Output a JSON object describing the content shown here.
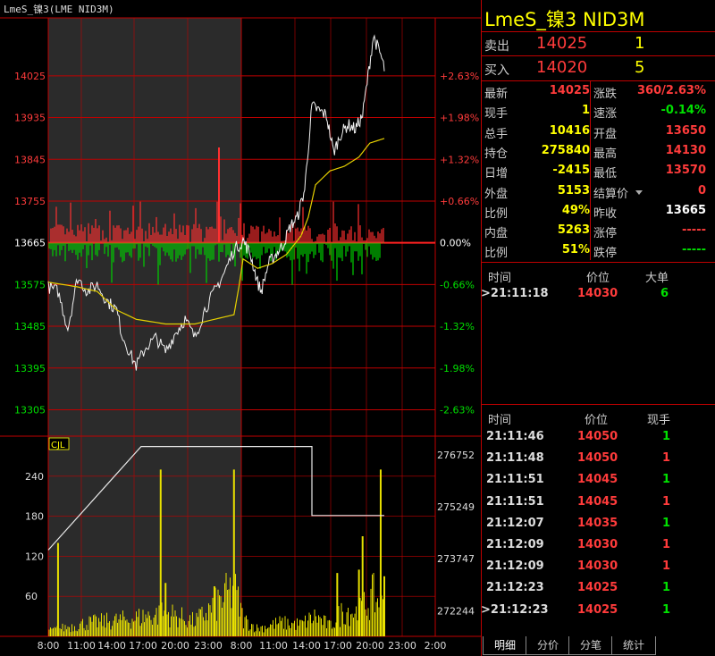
{
  "window_title": "LmeS_镍3(LME NID3M)",
  "symbol_title": "LmeS_镍3  NID3M",
  "colors": {
    "up": "#ff3b3b",
    "down": "#00e000",
    "grid": "#c00000",
    "avg": "#e6d000",
    "text_yellow": "#ffff00"
  },
  "quote": {
    "sell_label": "卖出",
    "sell_price": "14025",
    "sell_vol": "1",
    "buy_label": "买入",
    "buy_price": "14020",
    "buy_vol": "5"
  },
  "stats": [
    {
      "l": "最新",
      "v": "14025",
      "vc": "red",
      "l2": "涨跌",
      "v2": "360/2.63%",
      "v2c": "red"
    },
    {
      "l": "现手",
      "v": "1",
      "vc": "yellow",
      "l2": "速涨",
      "v2": "-0.14%",
      "v2c": "green"
    },
    {
      "l": "总手",
      "v": "10416",
      "vc": "yellow",
      "l2": "开盘",
      "v2": "13650",
      "v2c": "red"
    },
    {
      "l": "持仓",
      "v": "275840",
      "vc": "yellow",
      "l2": "最高",
      "v2": "14130",
      "v2c": "red"
    },
    {
      "l": "日增",
      "v": "-2415",
      "vc": "yellow",
      "l2": "最低",
      "v2": "13570",
      "v2c": "red"
    },
    {
      "l": "外盘",
      "v": "5153",
      "vc": "yellow",
      "l2": "结算价",
      "v2": "0",
      "v2c": "red"
    },
    {
      "l": "比例",
      "v": "49%",
      "vc": "yellow",
      "l2": "昨收",
      "v2": "13665",
      "v2c": "white"
    },
    {
      "l": "内盘",
      "v": "5263",
      "vc": "yellow",
      "l2": "涨停",
      "v2": "-----",
      "v2c": "red"
    },
    {
      "l": "比例",
      "v": "51%",
      "vc": "yellow",
      "l2": "跌停",
      "v2": "-----",
      "v2c": "green"
    }
  ],
  "big_orders": {
    "headers": [
      "时间",
      "价位",
      "大单"
    ],
    "rows": [
      {
        "time": ">21:11:18",
        "price": "14030",
        "vol": "6",
        "vc": "green"
      }
    ]
  },
  "ticks": {
    "headers": [
      "时间",
      "价位",
      "现手"
    ],
    "rows": [
      {
        "time": "21:11:46",
        "price": "14050",
        "vol": "1",
        "vc": "green"
      },
      {
        "time": "21:11:48",
        "price": "14050",
        "vol": "1",
        "vc": "red"
      },
      {
        "time": "21:11:51",
        "price": "14045",
        "vol": "1",
        "vc": "green"
      },
      {
        "time": "21:11:51",
        "price": "14045",
        "vol": "1",
        "vc": "red"
      },
      {
        "time": "21:12:07",
        "price": "14035",
        "vol": "1",
        "vc": "green"
      },
      {
        "time": "21:12:09",
        "price": "14030",
        "vol": "1",
        "vc": "red"
      },
      {
        "time": "21:12:09",
        "price": "14030",
        "vol": "1",
        "vc": "red"
      },
      {
        "time": "21:12:23",
        "price": "14025",
        "vol": "1",
        "vc": "green"
      },
      {
        "time": ">21:12:23",
        "price": "14025",
        "vol": "1",
        "vc": "green"
      }
    ]
  },
  "tabs": [
    "明细",
    "分价",
    "分笔",
    "统计"
  ],
  "chart_data": {
    "type": "line",
    "prev_close": 13665,
    "price_ticks": [
      "14025",
      "13935",
      "13845",
      "13755",
      "13665",
      "13575",
      "13485",
      "13395",
      "13305"
    ],
    "price_tick_values": [
      14025,
      13935,
      13845,
      13755,
      13665,
      13575,
      13485,
      13395,
      13305
    ],
    "pct_ticks": [
      "+2.63%",
      "+1.98%",
      "+1.32%",
      "+0.66%",
      "0.00%",
      "-0.66%",
      "-1.32%",
      "-1.98%",
      "-2.63%"
    ],
    "volume_label": "CJL",
    "volume_ticks": [
      "240",
      "180",
      "120",
      "60"
    ],
    "volume_tick_values": [
      240,
      180,
      120,
      60
    ],
    "oi_ticks": [
      "276752",
      "275249",
      "273747",
      "272244"
    ],
    "oi_tick_values": [
      276752,
      275249,
      273747,
      272244
    ],
    "time_ticks": [
      "8:00",
      "11:00",
      "14:00",
      "17:00",
      "20:00",
      "23:00",
      "8:00",
      "11:00",
      "14:00",
      "17:00",
      "20:00",
      "23:00",
      "2:00"
    ],
    "price_anchors": [
      [
        0,
        13570
      ],
      [
        2,
        13560
      ],
      [
        4,
        13480
      ],
      [
        6,
        13590
      ],
      [
        8,
        13560
      ],
      [
        10,
        13575
      ],
      [
        12,
        13540
      ],
      [
        14,
        13520
      ],
      [
        15,
        13470
      ],
      [
        17,
        13420
      ],
      [
        18,
        13400
      ],
      [
        20,
        13440
      ],
      [
        22,
        13460
      ],
      [
        24,
        13430
      ],
      [
        26,
        13470
      ],
      [
        28,
        13500
      ],
      [
        30,
        13460
      ],
      [
        32,
        13520
      ],
      [
        34,
        13560
      ],
      [
        36,
        13600
      ],
      [
        38,
        13650
      ],
      [
        40,
        13670
      ],
      [
        42,
        13640
      ],
      [
        44,
        13580
      ],
      [
        45,
        13560
      ],
      [
        47,
        13620
      ],
      [
        49,
        13640
      ],
      [
        51,
        13660
      ],
      [
        53,
        13700
      ],
      [
        55,
        13720
      ],
      [
        57,
        13780
      ],
      [
        59,
        13960
      ],
      [
        61,
        13950
      ],
      [
        63,
        13940
      ],
      [
        65,
        13860
      ],
      [
        67,
        13900
      ],
      [
        69,
        13920
      ],
      [
        71,
        13910
      ],
      [
        73,
        13940
      ],
      [
        76,
        14110
      ],
      [
        78,
        14070
      ],
      [
        79,
        14040
      ]
    ],
    "avg_anchors": [
      [
        0,
        13580
      ],
      [
        6,
        13570
      ],
      [
        10,
        13560
      ],
      [
        14,
        13520
      ],
      [
        18,
        13500
      ],
      [
        24,
        13490
      ],
      [
        30,
        13490
      ],
      [
        34,
        13500
      ],
      [
        38,
        13510
      ],
      [
        40,
        13630
      ],
      [
        44,
        13610
      ],
      [
        48,
        13620
      ],
      [
        52,
        13640
      ],
      [
        56,
        13680
      ],
      [
        58,
        13720
      ],
      [
        60,
        13790
      ],
      [
        64,
        13820
      ],
      [
        68,
        13830
      ],
      [
        72,
        13850
      ],
      [
        75,
        13880
      ],
      [
        79,
        13890
      ]
    ],
    "volume_anchors": [
      [
        0,
        8
      ],
      [
        8,
        20
      ],
      [
        16,
        25
      ],
      [
        24,
        35
      ],
      [
        30,
        22
      ],
      [
        34,
        45
      ],
      [
        38,
        70
      ],
      [
        40,
        25
      ],
      [
        44,
        12
      ],
      [
        50,
        20
      ],
      [
        56,
        18
      ],
      [
        60,
        30
      ],
      [
        64,
        15
      ],
      [
        68,
        40
      ],
      [
        72,
        35
      ],
      [
        76,
        60
      ],
      [
        79,
        40
      ]
    ],
    "volume_spikes": [
      [
        2,
        140
      ],
      [
        23,
        250
      ],
      [
        24,
        80
      ],
      [
        34,
        75
      ],
      [
        38,
        250
      ],
      [
        66,
        95
      ],
      [
        72,
        100
      ],
      [
        73,
        150
      ],
      [
        78,
        250
      ],
      [
        79,
        90
      ]
    ],
    "volume_ylim": [
      0,
      300
    ],
    "oi_steps": [
      [
        0,
        274000
      ],
      [
        19,
        277000
      ],
      [
        59,
        277000
      ],
      [
        59,
        275000
      ],
      [
        79,
        275000
      ]
    ],
    "oi_ylim": [
      271500,
      277300
    ],
    "ylim": [
      13250,
      14150
    ]
  }
}
